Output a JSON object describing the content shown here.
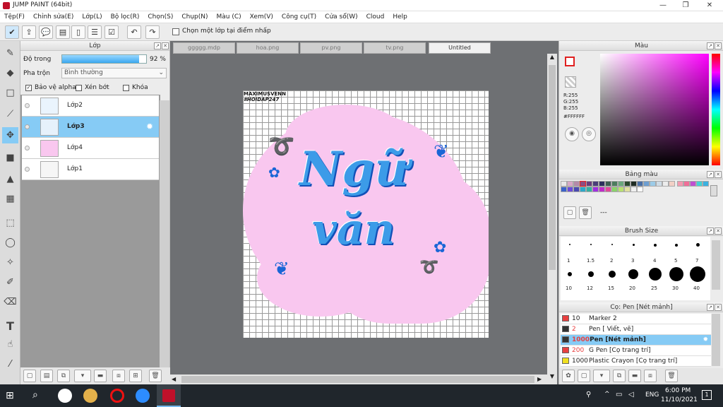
{
  "window": {
    "title": "JUMP PAINT (64bit)",
    "min": "—",
    "max": "❐",
    "close": "✕"
  },
  "menu": [
    "Tệp(F)",
    "Chỉnh sửa(E)",
    "Lớp(L)",
    "Bộ lọc(R)",
    "Chọn(S)",
    "Chụp(N)",
    "Màu (C)",
    "Xem(V)",
    "Công cụ(T)",
    "Cửa sổ(W)",
    "Cloud",
    "Help"
  ],
  "toolbar": {
    "checkbox_label": "Chọn một lớp tại điểm nhấp"
  },
  "layer_panel": {
    "title": "Lớp",
    "opacity_label": "Độ trong",
    "opacity_value": "92 %",
    "opacity_fraction": 0.92,
    "blend_label": "Pha trộn",
    "blend_value": "Bình thường",
    "chk_alpha": "Bảo vệ alpha",
    "chk_clip": "Xén bớt",
    "chk_lock": "Khóa",
    "layers": [
      {
        "name": "Lớp2"
      },
      {
        "name": "Lớp3"
      },
      {
        "name": "Lớp4"
      },
      {
        "name": "Lớp1"
      }
    ]
  },
  "doc_tabs": [
    "ggggg.mdp",
    "hoa.png",
    "pv.png",
    "tv.png",
    "Untitled"
  ],
  "artwork": {
    "text1": "MAXIMUSVENN",
    "text2": "#HOIDAP247",
    "word1": "Ngữ",
    "word2": "văn"
  },
  "color_panel": {
    "title": "Màu",
    "r": "R:255",
    "g": "G:255",
    "b": "B:255",
    "hex": "#FFFFFF"
  },
  "palette_panel": {
    "title": "Bảng màu",
    "dash": "---"
  },
  "brush_size_panel": {
    "title": "Brush Size",
    "row1": [
      "1",
      "1.5",
      "2",
      "3",
      "4",
      "5",
      "7"
    ],
    "row2": [
      "10",
      "12",
      "15",
      "20",
      "25",
      "30",
      "40"
    ]
  },
  "brush_panel": {
    "title": "Cọ: Pen [Nét mảnh]",
    "brushes": [
      {
        "size": "10",
        "name": "Marker 2",
        "color": "#e84040"
      },
      {
        "size": "2",
        "name": "Pen [ Viết, vẽ]",
        "color": "#333333"
      },
      {
        "size": "1000",
        "name": "Pen [Nét mảnh]",
        "color": "#333333"
      },
      {
        "size": "200",
        "name": "G Pen [Cọ trang trí]",
        "color": "#e84040"
      },
      {
        "size": "1000",
        "name": "Plastic Crayon [Cọ trang trí]",
        "color": "#f0e020"
      }
    ]
  },
  "taskbar": {
    "time": "6:00 PM",
    "date": "11/10/2021",
    "lang": "ENG",
    "notif": "1"
  }
}
